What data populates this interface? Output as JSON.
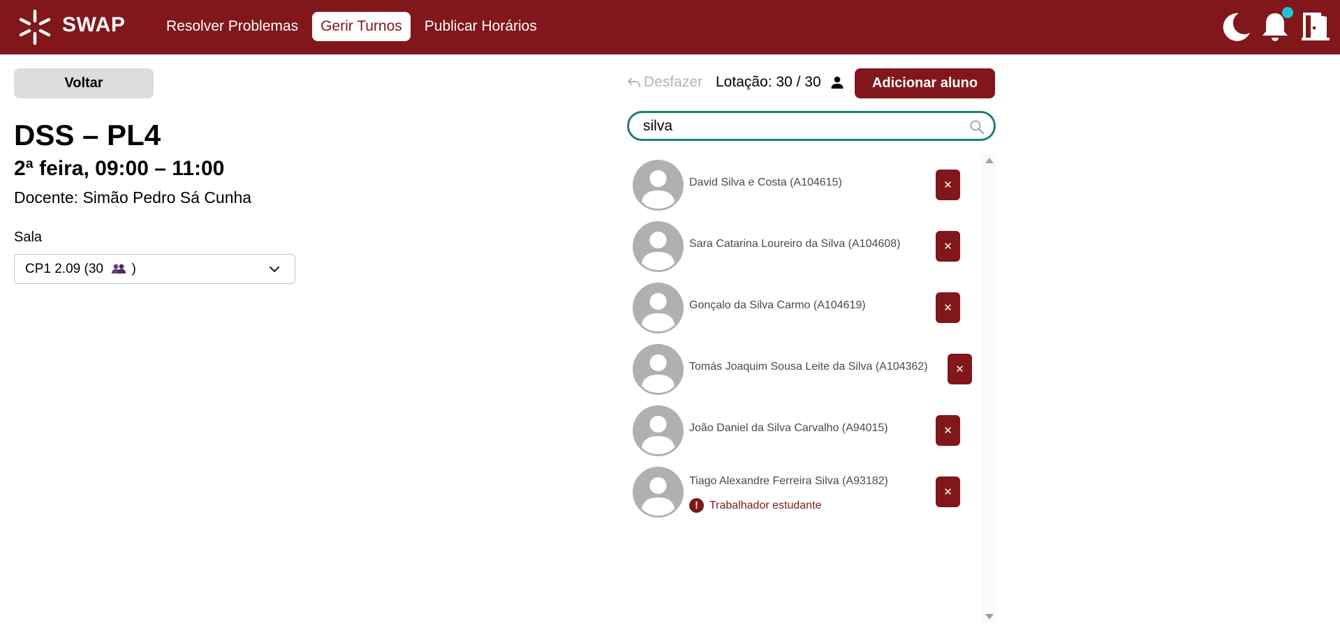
{
  "header": {
    "brand": "SWAP",
    "nav": [
      {
        "label": "Resolver Problemas",
        "active": false
      },
      {
        "label": "Gerir Turnos",
        "active": true
      },
      {
        "label": "Publicar Horários",
        "active": false
      }
    ],
    "icons": [
      "moon-icon",
      "bell-icon",
      "logout-door-icon"
    ],
    "colors": {
      "primary": "#81161b",
      "notification_dot": "#22c3d6"
    }
  },
  "left": {
    "back_label": "Voltar",
    "title": "DSS – PL4",
    "schedule": "2ª feira, 09:00 – 11:00",
    "teacher": "Docente: Simão Pedro Sá Cunha",
    "room_label": "Sala",
    "room_value_prefix": "CP1 2.09 (30",
    "room_value_suffix": ")"
  },
  "right": {
    "undo_label": "Desfazer",
    "capacity": "Lotação: 30 / 30",
    "add_label": "Adicionar aluno",
    "search_value": "silva",
    "students": [
      {
        "name": "David Silva e Costa (A104615)",
        "warning": ""
      },
      {
        "name": "Sara Catarina Loureiro da Silva (A104608)",
        "warning": ""
      },
      {
        "name": "Gonçalo da Silva Carmo (A104619)",
        "warning": ""
      },
      {
        "name": "Tomás Joaquim Sousa Leite da Silva (A104362)",
        "warning": ""
      },
      {
        "name": "João Daniel da Silva Carvalho (A94015)",
        "warning": ""
      },
      {
        "name": "Tiago Alexandre Ferreira Silva (A93182)",
        "warning": "Trabalhador estudante"
      }
    ],
    "remove_symbol": "✕",
    "warning_symbol": "!"
  }
}
